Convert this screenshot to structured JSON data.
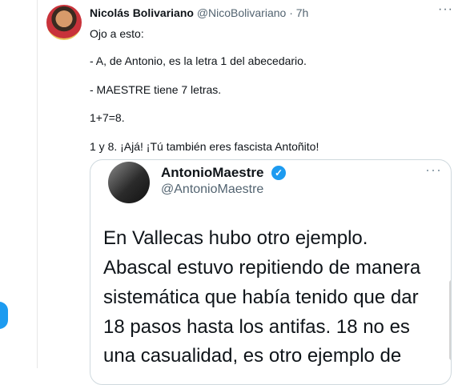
{
  "tweet": {
    "author_name": "Nicolás Bolivariano",
    "author_handle": "@NicoBolivariano",
    "separator": " · ",
    "time": "7h",
    "more": "···",
    "lines": [
      "Ojo a esto:",
      "- A, de Antonio, es la letra 1 del abecedario.",
      "- MAESTRE tiene 7 letras.",
      "1+7=8.",
      "1 y 8. ¡Ajá! ¡Tú también eres fascista Antoñito!"
    ]
  },
  "quoted": {
    "author_name": "AntonioMaestre",
    "verified_glyph": "✓",
    "author_handle": "@AntonioMaestre",
    "more": "···",
    "lines": [
      "En Vallecas hubo otro ejemplo.",
      "Abascal estuvo repitiendo de manera",
      "sistemática que había tenido que dar",
      "18 pasos hasta los antifas. 18 no es",
      "una casualidad, es otro ejemplo de"
    ]
  },
  "colors": {
    "accent": "#1d9bf0",
    "text": "#0f1419",
    "secondary": "#536471",
    "border": "#cfd9de"
  }
}
